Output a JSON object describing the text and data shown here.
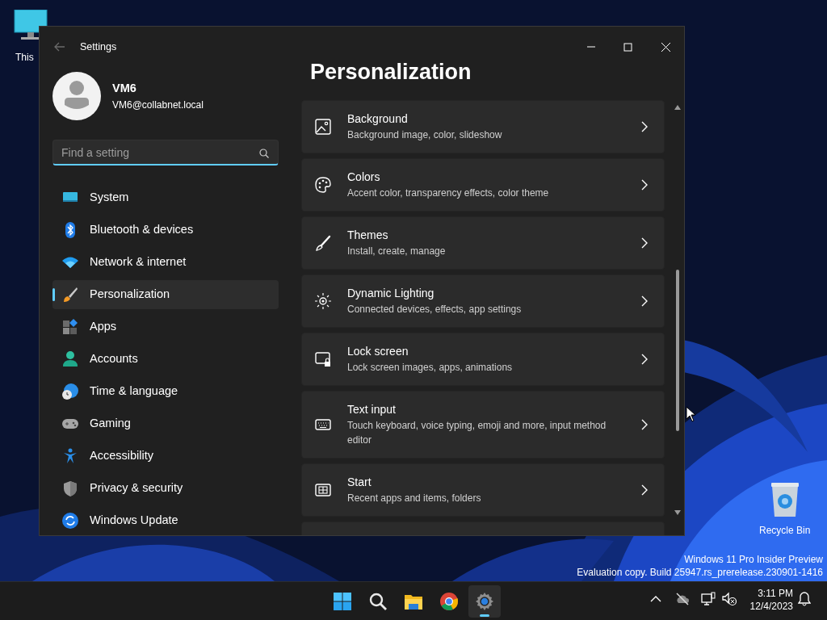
{
  "desktop_icons": [
    {
      "label": "This"
    },
    {
      "label": "Recycle Bin"
    }
  ],
  "window": {
    "title": "Settings",
    "user": {
      "name": "VM6",
      "email": "VM6@collabnet.local"
    },
    "search": {
      "placeholder": "Find a setting"
    },
    "nav": [
      {
        "label": "System",
        "selected": false
      },
      {
        "label": "Bluetooth & devices",
        "selected": false
      },
      {
        "label": "Network & internet",
        "selected": false
      },
      {
        "label": "Personalization",
        "selected": true
      },
      {
        "label": "Apps",
        "selected": false
      },
      {
        "label": "Accounts",
        "selected": false
      },
      {
        "label": "Time & language",
        "selected": false
      },
      {
        "label": "Gaming",
        "selected": false
      },
      {
        "label": "Accessibility",
        "selected": false
      },
      {
        "label": "Privacy & security",
        "selected": false
      },
      {
        "label": "Windows Update",
        "selected": false
      }
    ],
    "page_title": "Personalization",
    "items": [
      {
        "title": "Background",
        "subtitle": "Background image, color, slideshow"
      },
      {
        "title": "Colors",
        "subtitle": "Accent color, transparency effects, color theme"
      },
      {
        "title": "Themes",
        "subtitle": "Install, create, manage"
      },
      {
        "title": "Dynamic Lighting",
        "subtitle": "Connected devices, effects, app settings"
      },
      {
        "title": "Lock screen",
        "subtitle": "Lock screen images, apps, animations"
      },
      {
        "title": "Text input",
        "subtitle": "Touch keyboard, voice typing, emoji and more, input method editor"
      },
      {
        "title": "Start",
        "subtitle": "Recent apps and items, folders"
      }
    ]
  },
  "evaluation_notice": [
    "Windows 11 Pro Insider Preview",
    "Evaluation copy. Build 25947.rs_prerelease.230901-1416"
  ],
  "taskbar": {
    "apps": [
      {
        "kind": "start",
        "running": false
      },
      {
        "kind": "search",
        "running": false
      },
      {
        "kind": "files",
        "running": false
      },
      {
        "kind": "browser",
        "running": false
      },
      {
        "kind": "settings",
        "running": true
      }
    ],
    "time": "3:11 PM",
    "date": "12/4/2023"
  }
}
